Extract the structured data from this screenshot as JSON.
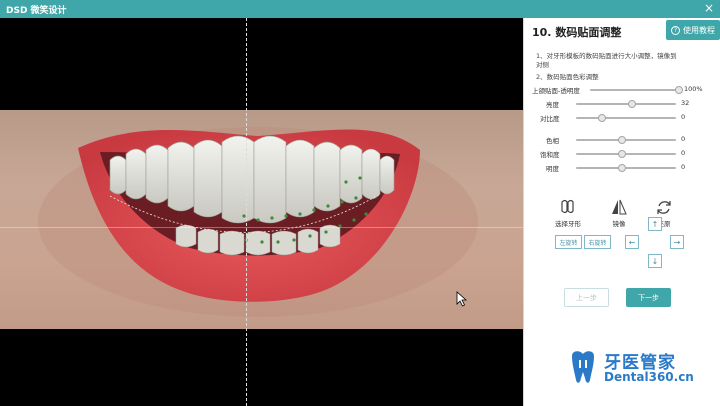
{
  "window": {
    "title": "DSD 微笑设计",
    "close_glyph": "×"
  },
  "panel": {
    "help_label": "使用教程",
    "step_title": "10. 数码贴面调整",
    "instructions": [
      "1、对牙形模板的数码贴面进行大小调整，镜像到",
      "对侧",
      "2、数码贴面色彩调整"
    ],
    "sliders": [
      {
        "label": "上颌贴面-透明度",
        "value": "100%",
        "level": 1.0
      },
      {
        "label": "亮度",
        "value": "32",
        "level": 0.5
      },
      {
        "label": "对比度",
        "value": "0",
        "level": 0.2
      },
      {
        "label": "色相",
        "value": "0",
        "level": 0.5
      },
      {
        "label": "饱和度",
        "value": "0",
        "level": 0.5
      },
      {
        "label": "明度",
        "value": "0",
        "level": 0.5
      }
    ],
    "tools": [
      {
        "label": "选择牙形",
        "icon": "tooth-select-icon"
      },
      {
        "label": "镜像",
        "icon": "mirror-icon"
      },
      {
        "label": "还原",
        "icon": "restore-icon"
      }
    ],
    "rotate_buttons": [
      {
        "label": "左旋转"
      },
      {
        "label": "右旋转"
      }
    ],
    "arrows": {
      "up": "↑",
      "down": "↓",
      "left": "←",
      "right": "→"
    },
    "prev_label": "上一步",
    "next_label": "下一步"
  },
  "logo": {
    "cn": "牙医管家",
    "en": "Dental360.cn"
  },
  "colors": {
    "accent": "#3fa7a9",
    "logo": "#2a7ac8"
  }
}
